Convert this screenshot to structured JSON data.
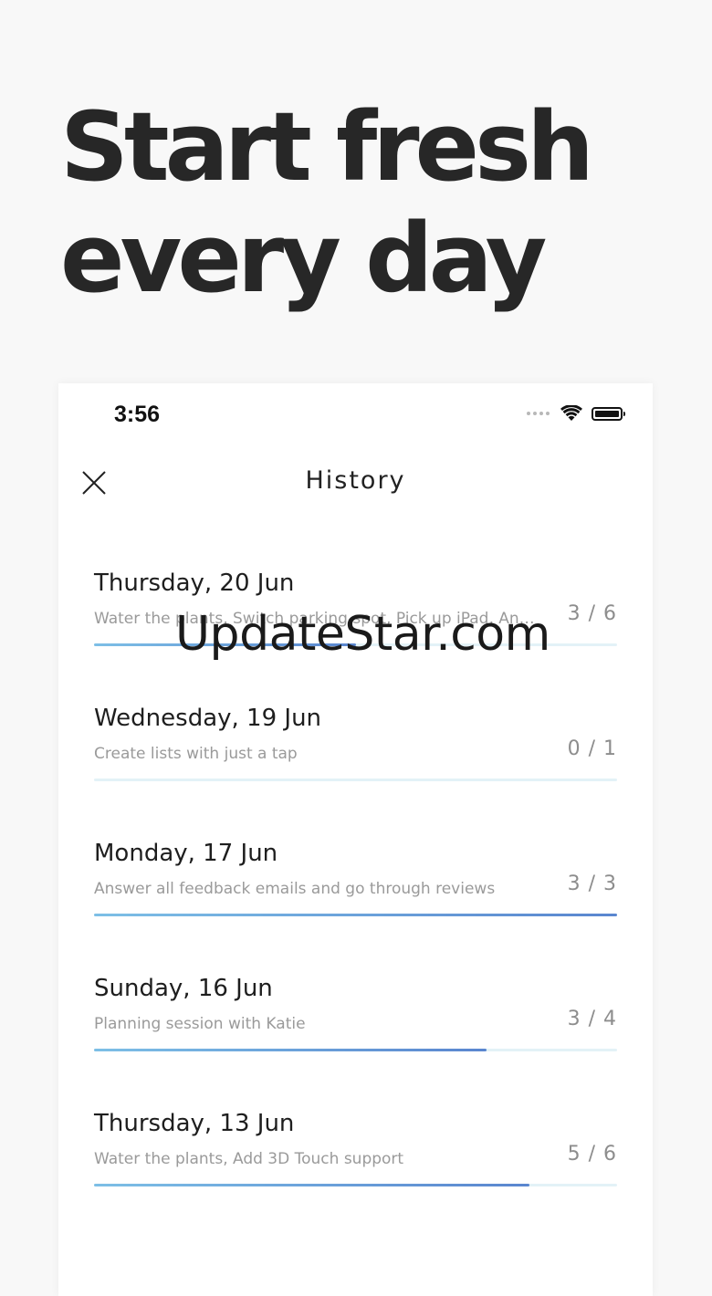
{
  "headline": {
    "line1": "Start fresh",
    "line2": "every day"
  },
  "status_bar": {
    "time": "3:56",
    "icons": [
      "signal-dots-icon",
      "wifi-icon",
      "battery-icon"
    ]
  },
  "nav": {
    "title": "History",
    "close_icon": "close-icon"
  },
  "history": [
    {
      "date": "Thursday, 20 Jun",
      "tasks": "Water the plants, Switch parking spot, Pick up iPad, Answer all feedback emails",
      "count": "3 / 6",
      "progress": 0.5
    },
    {
      "date": "Wednesday, 19 Jun",
      "tasks": "Create lists with just a tap",
      "count": "0 / 1",
      "progress": 0.0
    },
    {
      "date": "Monday, 17 Jun",
      "tasks": "Answer all feedback emails and go through reviews",
      "count": "3 / 3",
      "progress": 1.0
    },
    {
      "date": "Sunday, 16 Jun",
      "tasks": "Planning session with Katie",
      "count": "3 / 4",
      "progress": 0.75
    },
    {
      "date": "Thursday, 13 Jun",
      "tasks": "Water the plants, Add 3D Touch support",
      "count": "5 / 6",
      "progress": 0.833
    }
  ],
  "watermark": "UpdateStar.com",
  "colors": {
    "track": "#e3f2f7",
    "progress_start": "#7dbfe6",
    "progress_end": "#5a86cf",
    "headline": "#272727"
  }
}
